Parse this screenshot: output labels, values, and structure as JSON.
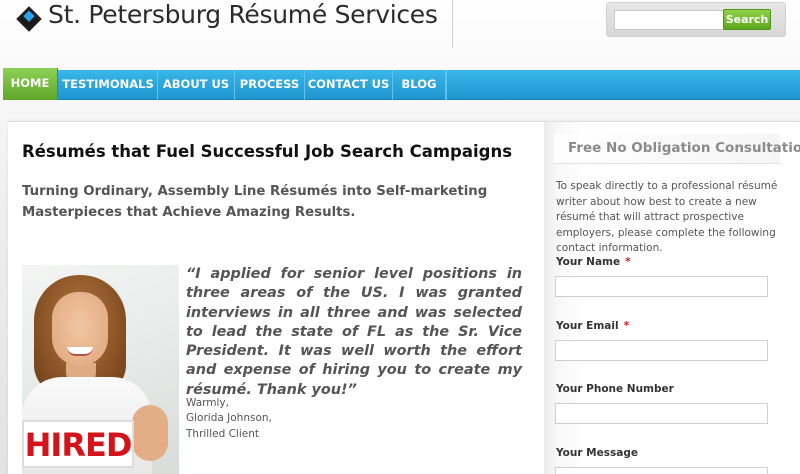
{
  "header": {
    "site_title": "St. Petersburg Résumé Services",
    "search_placeholder": "",
    "search_button": "Search"
  },
  "nav": {
    "items": [
      {
        "label": "HOME",
        "active": true
      },
      {
        "label": "TESTIMONALS",
        "active": false
      },
      {
        "label": "ABOUT US",
        "active": false
      },
      {
        "label": "PROCESS",
        "active": false
      },
      {
        "label": "CONTACT US",
        "active": false
      },
      {
        "label": "BLOG",
        "active": false
      }
    ]
  },
  "main": {
    "title": "Résumés that Fuel Successful Job Search Campaigns",
    "subtitle": "Turning Ordinary, Assembly Line Résumés into Self-marketing Masterpieces that Achieve Amazing Results.",
    "photo_sign": "HIRED",
    "quote": "“I applied for senior level positions in three areas of the US.  I was granted interviews in all three and was selected to lead the state of FL as the Sr. Vice President. It was well worth the effort and expense of hiring you to create my résumé. Thank you!”",
    "signature": {
      "line1": "Warmly,",
      "line2": "Glorida Johnson,",
      "line3": "Thrilled Client"
    }
  },
  "sidebar": {
    "title": "Free No Obligation Consultation",
    "intro": "To speak directly to a professional résumé writer about how best to create a new résumé that will attract prospective employers, please complete the following contact information.",
    "fields": [
      {
        "label": "Your Name",
        "required": "*"
      },
      {
        "label": "Your Email",
        "required": "*"
      },
      {
        "label": "Your Phone Number",
        "required": ""
      },
      {
        "label": "Your Message",
        "required": ""
      }
    ]
  },
  "colors": {
    "nav_blue": "#2aa3df",
    "nav_active_green": "#72bb3d",
    "search_green": "#6cb82a",
    "required_red": "#d31e1e"
  }
}
